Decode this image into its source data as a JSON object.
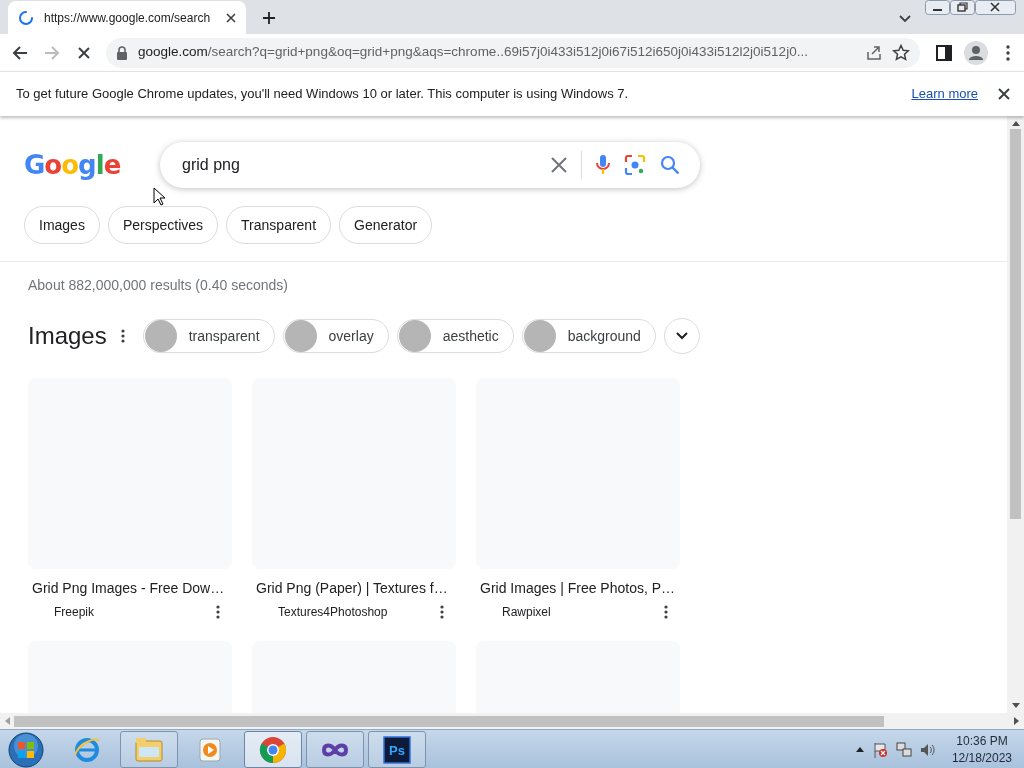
{
  "browser": {
    "tab": {
      "title": "https://www.google.com/search",
      "loading": true
    },
    "address": {
      "domain": "google.com",
      "path": "/search?q=grid+png&oq=grid+png&aqs=chrome..69i57j0i433i512j0i67i512i650j0i433i512l2j0i512j0..."
    },
    "infobar": {
      "message": "To get future Google Chrome updates, you'll need Windows 10 or later. This computer is using Windows 7.",
      "link": "Learn more"
    }
  },
  "page": {
    "logo": "Google",
    "search": {
      "value": "grid png"
    },
    "filters": [
      {
        "label": "Images"
      },
      {
        "label": "Perspectives"
      },
      {
        "label": "Transparent"
      },
      {
        "label": "Generator"
      }
    ],
    "result_stats": "About 882,000,000 results (0.40 seconds)",
    "images": {
      "heading": "Images",
      "chips": [
        {
          "label": "transparent"
        },
        {
          "label": "overlay"
        },
        {
          "label": "aesthetic"
        },
        {
          "label": "background"
        }
      ],
      "results": [
        {
          "kind": "captioned",
          "title": "Grid Png Images - Free Dow…",
          "source": "Freepik"
        },
        {
          "kind": "captioned",
          "title": "Grid Png (Paper) | Textures f…",
          "source": "Textures4Photoshop"
        },
        {
          "kind": "captioned",
          "title": "Grid Images | Free Photos, P…",
          "source": "Rawpixel"
        },
        {
          "kind": "bare"
        },
        {
          "kind": "bare"
        },
        {
          "kind": "bare"
        }
      ]
    }
  },
  "taskbar": {
    "apps": [
      {
        "kind": "ie",
        "running": false,
        "selected": false
      },
      {
        "kind": "explorer",
        "running": true,
        "selected": false
      },
      {
        "kind": "media",
        "running": false,
        "selected": false
      },
      {
        "kind": "chrome",
        "running": true,
        "selected": true
      },
      {
        "kind": "infinity",
        "running": true,
        "selected": false
      },
      {
        "kind": "ps",
        "running": true,
        "selected": false,
        "badge_text": "Ps"
      }
    ],
    "time": "10:36 PM",
    "date": "12/18/2023"
  }
}
